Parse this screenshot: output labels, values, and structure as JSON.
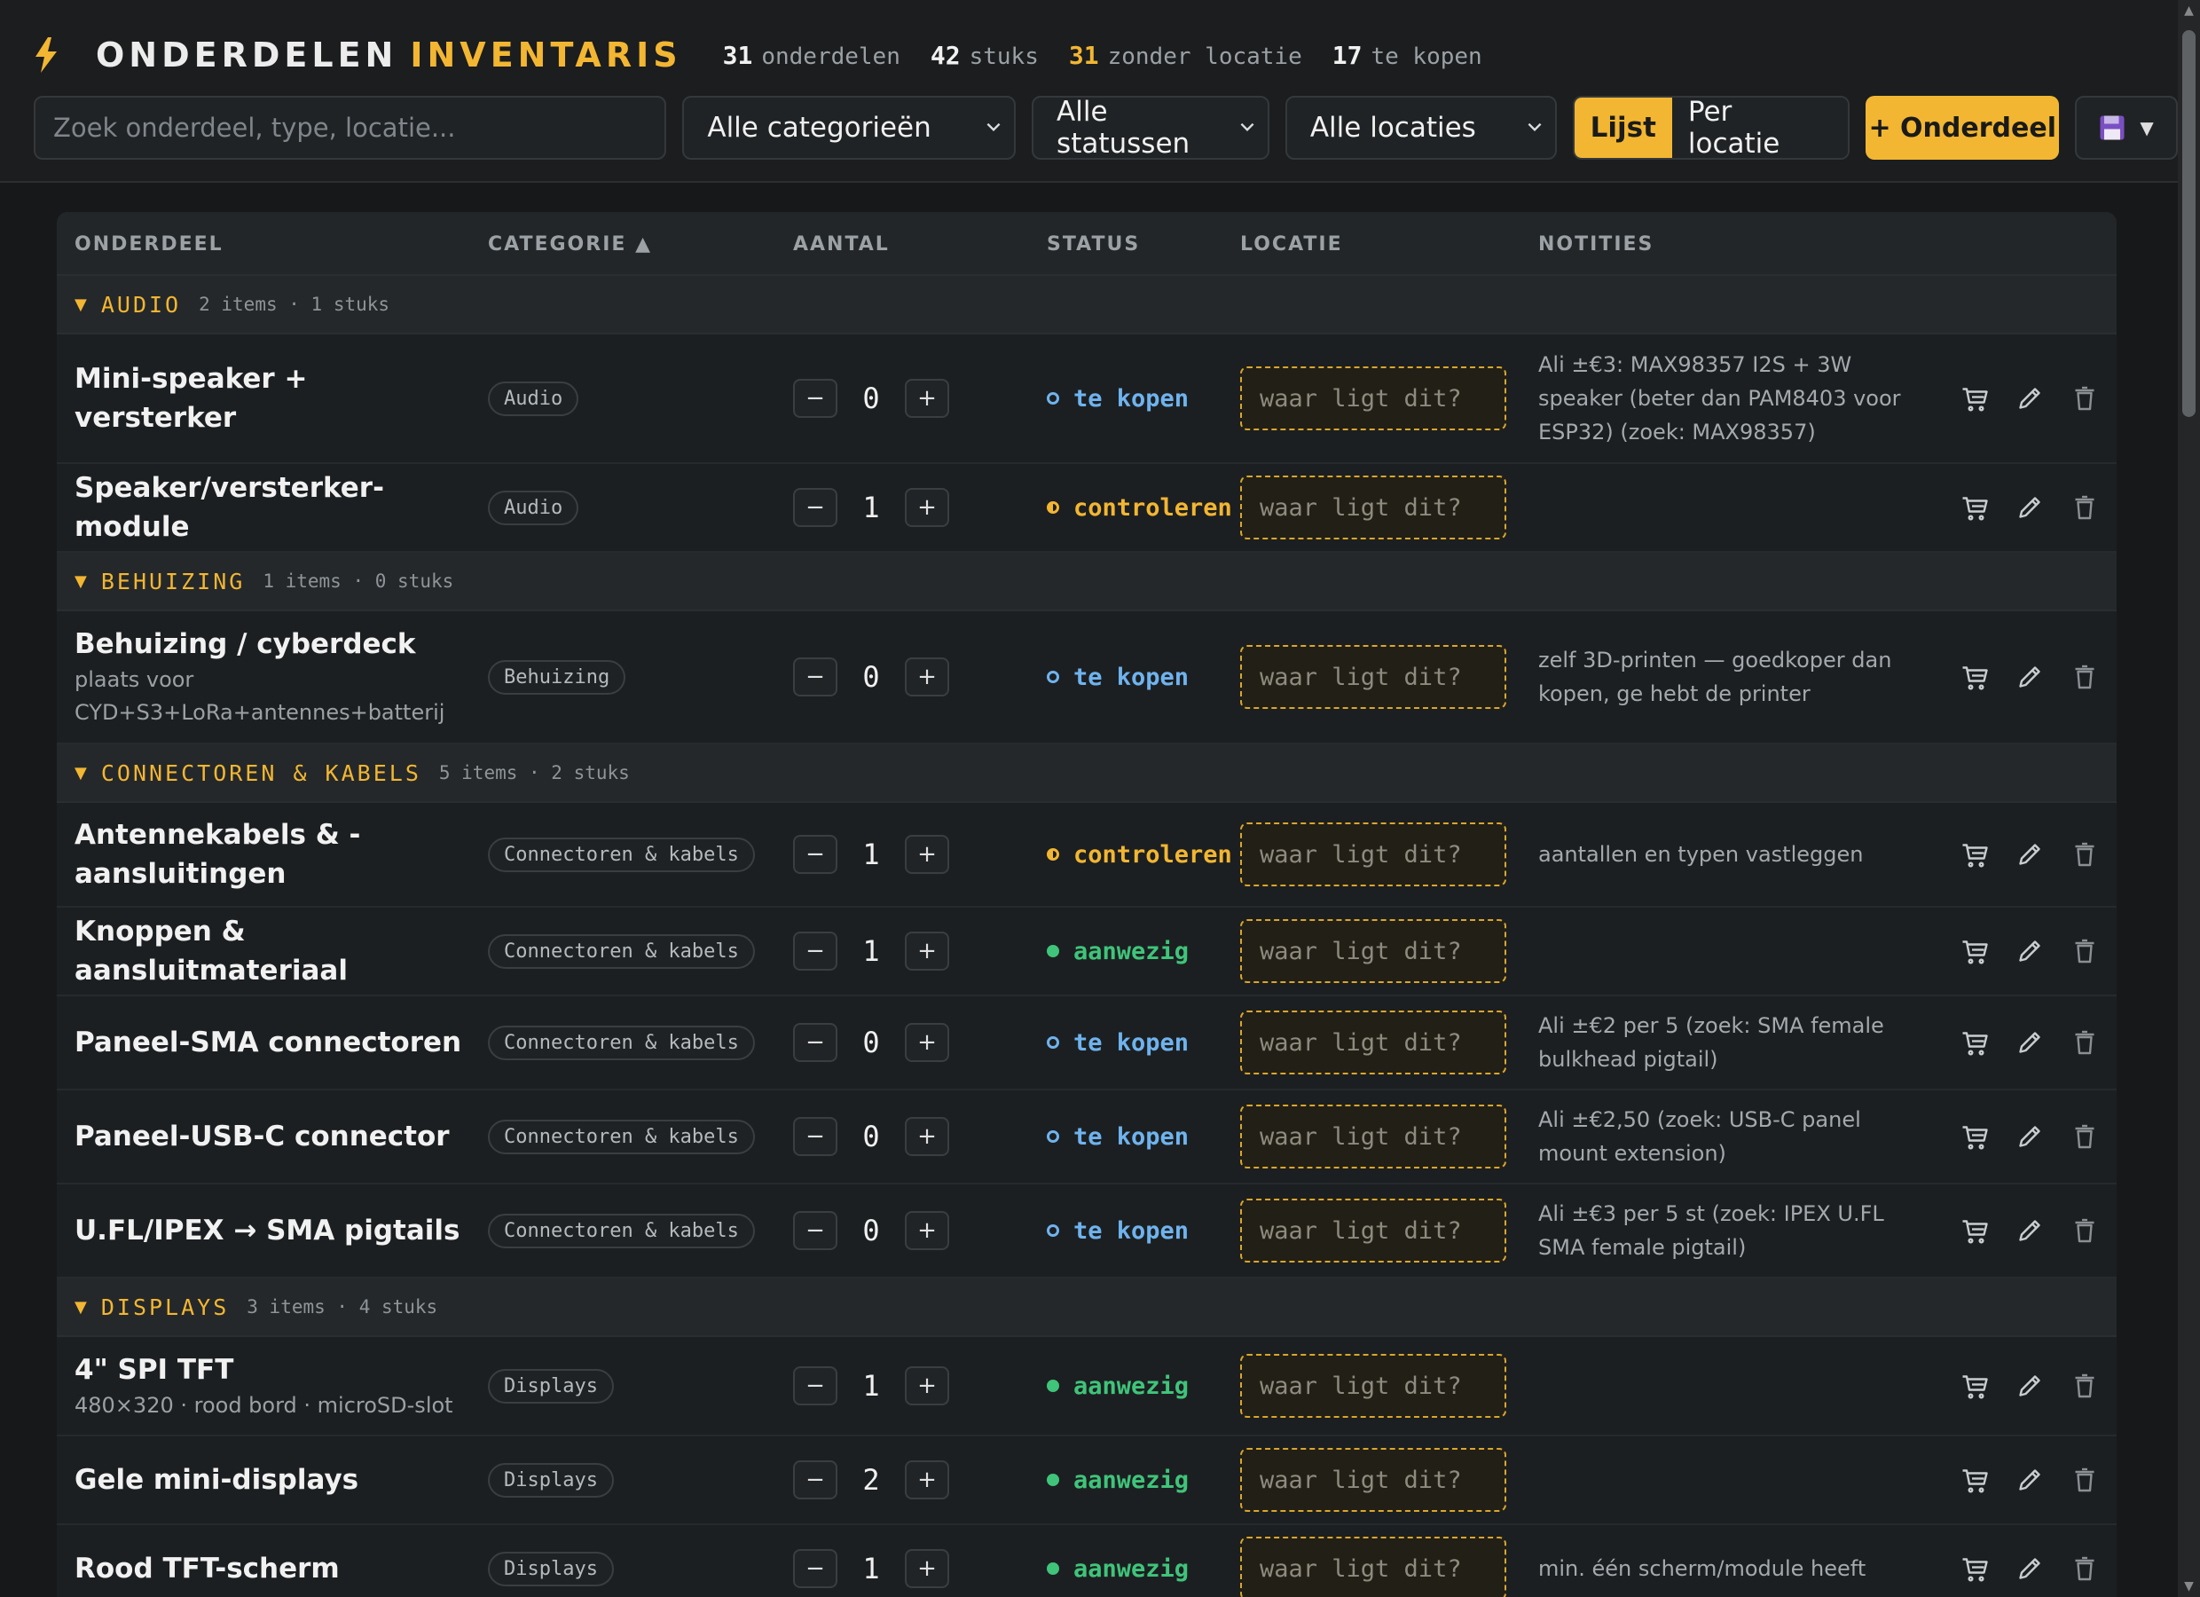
{
  "header": {
    "title_part1": "ONDERDELEN",
    "title_part2": "INVENTARIS",
    "stats": [
      {
        "value": "31",
        "label": "onderdelen"
      },
      {
        "value": "42",
        "label": "stuks"
      },
      {
        "value": "31",
        "label": "zonder locatie"
      },
      {
        "value": "17",
        "label": "te kopen"
      }
    ]
  },
  "toolbar": {
    "search_placeholder": "Zoek onderdeel, type, locatie...",
    "category_select": "Alle categorieën",
    "status_select": "Alle statussen",
    "location_select": "Alle locaties",
    "view_list": "Lijst",
    "view_location": "Per locatie",
    "add_button": "+ Onderdeel",
    "save_icon": "floppy-disk-icon"
  },
  "colors": {
    "accent": "#f2b632",
    "te_kopen": "#6fb3ee",
    "controleren": "#f2b632",
    "aanwezig": "#3fc47a"
  },
  "table": {
    "columns": [
      "ONDERDEEL",
      "CATEGORIE ▲",
      "AANTAL",
      "STATUS",
      "LOCATIE",
      "NOTITIES"
    ],
    "location_placeholder": "waar ligt dit?",
    "groups": [
      {
        "name": "AUDIO",
        "meta": "2 items · 1 stuks",
        "rows": [
          {
            "name": "Mini-speaker + versterker",
            "sub": "",
            "category": "Audio",
            "qty": "0",
            "status": "te kopen",
            "notes": "Ali ±€3: MAX98357 I2S + 3W speaker (beter dan PAM8403 voor ESP32) (zoek: MAX98357)"
          },
          {
            "name": "Speaker/versterker-module",
            "sub": "",
            "category": "Audio",
            "qty": "1",
            "status": "controleren",
            "notes": ""
          }
        ]
      },
      {
        "name": "BEHUIZING",
        "meta": "1 items · 0 stuks",
        "rows": [
          {
            "name": "Behuizing / cyberdeck",
            "sub": "plaats voor CYD+S3+LoRa+antennes+batterij",
            "category": "Behuizing",
            "qty": "0",
            "status": "te kopen",
            "notes": "zelf 3D-printen — goedkoper dan kopen, ge hebt de printer"
          }
        ]
      },
      {
        "name": "CONNECTOREN & KABELS",
        "meta": "5 items · 2 stuks",
        "rows": [
          {
            "name": "Antennekabels & -aansluitingen",
            "sub": "",
            "category": "Connectoren & kabels",
            "qty": "1",
            "status": "controleren",
            "notes": "aantallen en typen vastleggen"
          },
          {
            "name": "Knoppen & aansluitmateriaal",
            "sub": "",
            "category": "Connectoren & kabels",
            "qty": "1",
            "status": "aanwezig",
            "notes": ""
          },
          {
            "name": "Paneel-SMA connectoren",
            "sub": "",
            "category": "Connectoren & kabels",
            "qty": "0",
            "status": "te kopen",
            "notes": "Ali ±€2 per 5 (zoek: SMA female bulkhead pigtail)"
          },
          {
            "name": "Paneel-USB-C connector",
            "sub": "",
            "category": "Connectoren & kabels",
            "qty": "0",
            "status": "te kopen",
            "notes": "Ali ±€2,50 (zoek: USB-C panel mount extension)"
          },
          {
            "name": "U.FL/IPEX → SMA pigtails",
            "sub": "",
            "category": "Connectoren & kabels",
            "qty": "0",
            "status": "te kopen",
            "notes": "Ali ±€3 per 5 st (zoek: IPEX U.FL SMA female pigtail)"
          }
        ]
      },
      {
        "name": "DISPLAYS",
        "meta": "3 items · 4 stuks",
        "rows": [
          {
            "name": "4\" SPI TFT",
            "sub": "480×320 · rood bord · microSD-slot",
            "category": "Displays",
            "qty": "1",
            "status": "aanwezig",
            "notes": ""
          },
          {
            "name": "Gele mini-displays",
            "sub": "",
            "category": "Displays",
            "qty": "2",
            "status": "aanwezig",
            "notes": ""
          },
          {
            "name": "Rood TFT-scherm",
            "sub": "",
            "category": "Displays",
            "qty": "1",
            "status": "aanwezig",
            "notes": "min. één scherm/module heeft"
          }
        ]
      }
    ]
  }
}
